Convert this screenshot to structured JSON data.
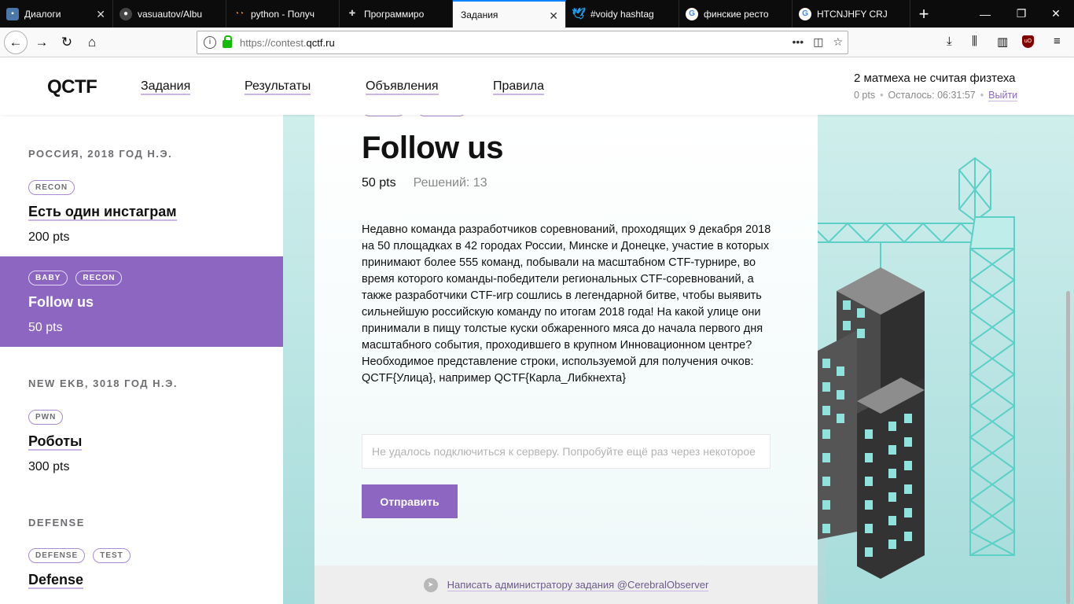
{
  "browser": {
    "tabs": [
      {
        "title": "Диалоги",
        "icon": "vk-icon",
        "color": "#4a76a8"
      },
      {
        "title": "vasuautov/Albu",
        "icon": "github-icon",
        "color": "#24292e"
      },
      {
        "title": "python - Получ",
        "icon": "glasses-icon",
        "color": "#f48024"
      },
      {
        "title": "Программиро",
        "icon": "game-icon",
        "color": "#333"
      },
      {
        "title": "Задания",
        "icon": "",
        "color": "#fff",
        "active": true
      },
      {
        "title": "#voidy hashtag",
        "icon": "twitter-icon",
        "color": "#1da1f2"
      },
      {
        "title": "финские ресто",
        "icon": "google-icon",
        "color": "#fff"
      },
      {
        "title": "HTCNJHFY CRJ",
        "icon": "google-icon",
        "color": "#fff"
      }
    ],
    "url_prefix": "https://contest.",
    "url_domain": "qctf.ru",
    "ublock_label": "uO"
  },
  "header": {
    "logo": "QCTF",
    "nav": [
      "Задания",
      "Результаты",
      "Объявления",
      "Правила"
    ],
    "team": "2 матмеха не считая физтеха",
    "points": "0 pts",
    "time_left": "Осталось: 06:31:57",
    "logout": "Выйти"
  },
  "sidebar": {
    "sections": [
      {
        "title": "РОССИЯ, 2018 ГОД Н.Э.",
        "tasks": [
          {
            "tags": [
              "RECON"
            ],
            "title": "Есть один инстаграм",
            "pts": "200 pts"
          },
          {
            "tags": [
              "BABY",
              "RECON"
            ],
            "title": "Follow us",
            "pts": "50 pts",
            "active": true
          }
        ]
      },
      {
        "title": "NEW EKB, 3018 ГОД Н.Э.",
        "tasks": [
          {
            "tags": [
              "PWN"
            ],
            "title": "Роботы",
            "pts": "300 pts"
          }
        ]
      },
      {
        "title": "DEFENSE",
        "tasks": [
          {
            "tags": [
              "DEFENSE",
              "TEST"
            ],
            "title": "Defense",
            "pts": ""
          }
        ]
      }
    ]
  },
  "task": {
    "title": "Follow us",
    "points": "50 pts",
    "solved": "Решений: 13",
    "description": "Недавно команда разработчиков соревнований, проходящих 9 декабря 2018 на 50 площадках в 42 городах России, Минске и Донецке, участие в которых принимают более 555 команд, побывали на масштабном CTF-турнире, во время которого команды-победители региональных CTF-соревнований, а также разработчики CTF-игр сошлись в легендарной битве, чтобы выявить сильнейшую российскую команду по итогам 2018 года! На какой улице они принимали в пищу толстые куски обжаренного мяса до начала первого дня масштабного события, проходившего в крупном Инновационном центре? Необходимое представление строки, используемой для получения очков: QCTF{Улица}, например QCTF{Карла_Либкнехта}",
    "input_placeholder": "Не удалось подключиться к серверу. Попробуйте ещё раз через некоторое",
    "submit": "Отправить",
    "contact": "Написать администратору задания @CerebralObserver"
  },
  "colors": {
    "accent": "#8c66c0",
    "accent_light": "#c9b6e6",
    "teal": "#5ccfc6",
    "bg_teal": "#a6dcdb"
  }
}
